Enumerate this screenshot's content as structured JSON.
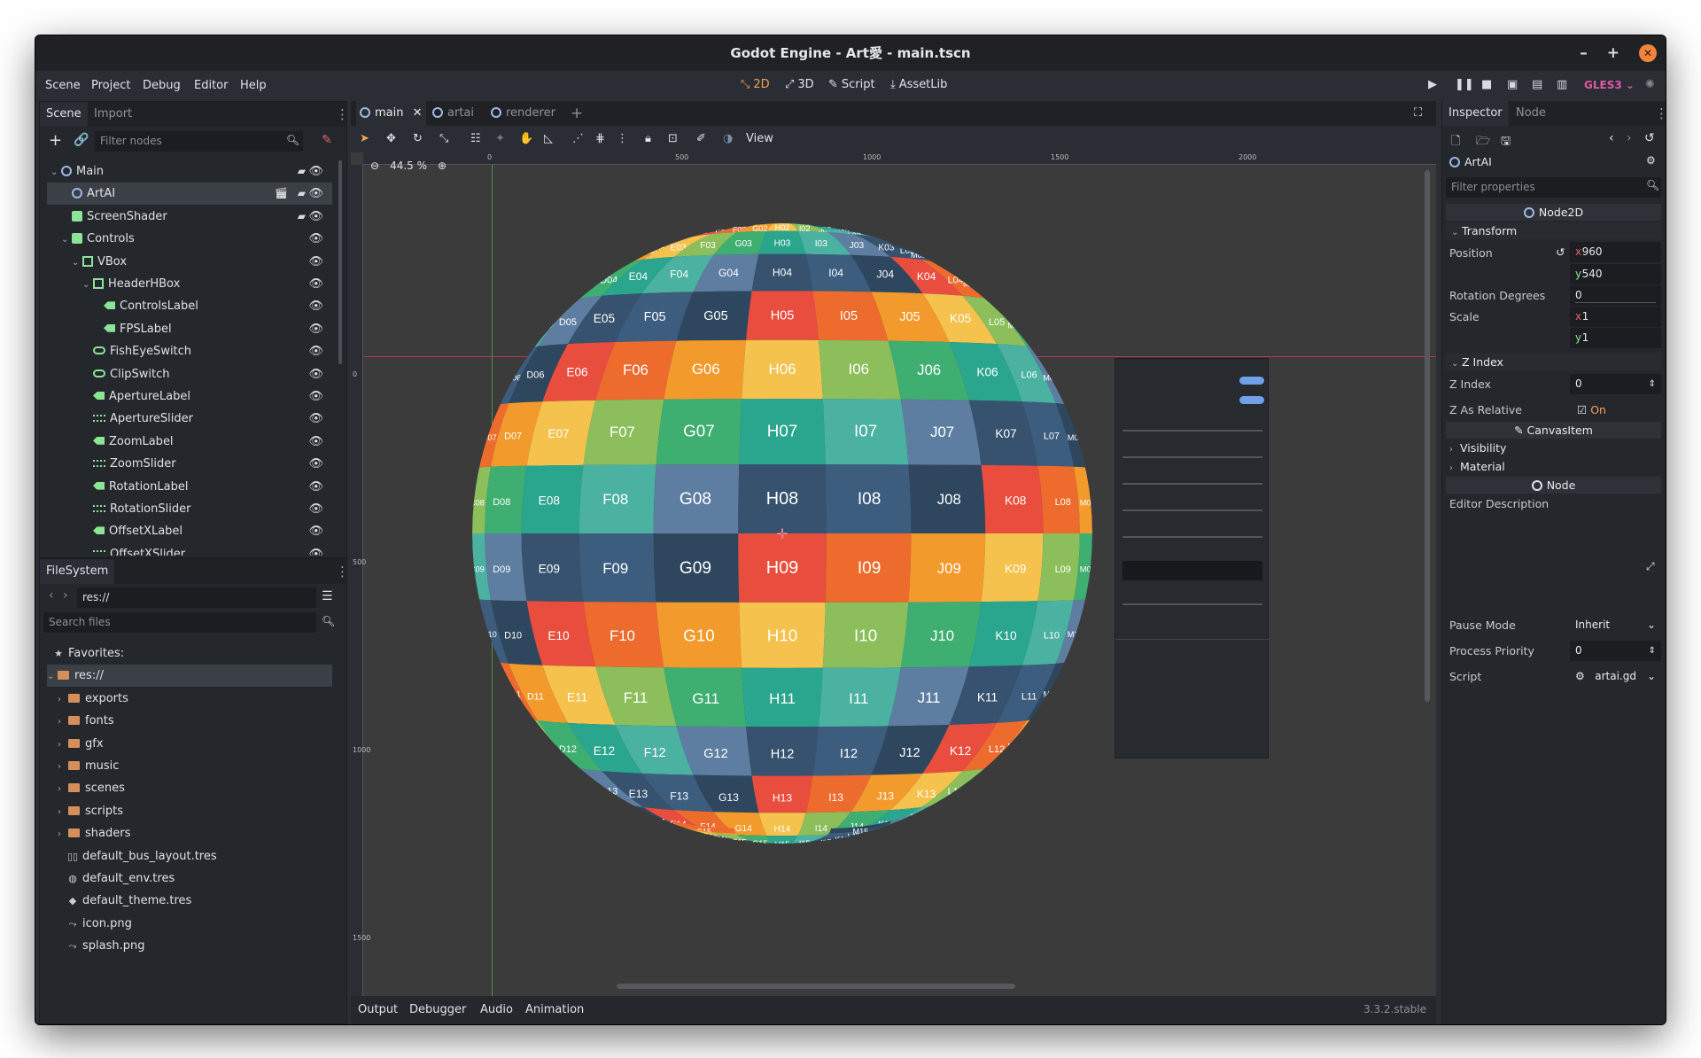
{
  "window": {
    "title": "Godot Engine - Art愛 - main.tscn"
  },
  "menus": [
    "Scene",
    "Project",
    "Debug",
    "Editor",
    "Help"
  ],
  "workspaces": [
    {
      "label": "2D",
      "icon": "2d-icon",
      "active": true
    },
    {
      "label": "3D",
      "icon": "3d-icon",
      "active": false
    },
    {
      "label": "Script",
      "icon": "script-icon",
      "active": false
    },
    {
      "label": "AssetLib",
      "icon": "assetlib-icon",
      "active": false
    }
  ],
  "renderer": "GLES3",
  "scene_panel": {
    "tabs": [
      "Scene",
      "Import"
    ],
    "filter_placeholder": "Filter nodes",
    "tree": [
      {
        "name": "Main",
        "depth": 0,
        "icon": "node2d",
        "expanded": true
      },
      {
        "name": "ArtAI",
        "depth": 1,
        "icon": "node2d",
        "selected": true
      },
      {
        "name": "ScreenShader",
        "depth": 1,
        "icon": "colorrect"
      },
      {
        "name": "Controls",
        "depth": 1,
        "icon": "control",
        "expanded": true
      },
      {
        "name": "VBox",
        "depth": 2,
        "icon": "vbox",
        "expanded": true
      },
      {
        "name": "HeaderHBox",
        "depth": 3,
        "icon": "hbox",
        "expanded": true
      },
      {
        "name": "ControlsLabel",
        "depth": 4,
        "icon": "label"
      },
      {
        "name": "FPSLabel",
        "depth": 4,
        "icon": "label"
      },
      {
        "name": "FishEyeSwitch",
        "depth": 3,
        "icon": "toggle"
      },
      {
        "name": "ClipSwitch",
        "depth": 3,
        "icon": "toggle"
      },
      {
        "name": "ApertureLabel",
        "depth": 3,
        "icon": "label"
      },
      {
        "name": "ApertureSlider",
        "depth": 3,
        "icon": "slider"
      },
      {
        "name": "ZoomLabel",
        "depth": 3,
        "icon": "label"
      },
      {
        "name": "ZoomSlider",
        "depth": 3,
        "icon": "slider"
      },
      {
        "name": "RotationLabel",
        "depth": 3,
        "icon": "label"
      },
      {
        "name": "RotationSlider",
        "depth": 3,
        "icon": "slider"
      },
      {
        "name": "OffsetXLabel",
        "depth": 3,
        "icon": "label"
      },
      {
        "name": "OffsetXSlider",
        "depth": 3,
        "icon": "slider"
      }
    ]
  },
  "filesystem": {
    "tab": "FileSystem",
    "path": "res://",
    "search_placeholder": "Search files",
    "favorites_label": "Favorites:",
    "root": "res://",
    "folders": [
      "exports",
      "fonts",
      "gfx",
      "music",
      "scenes",
      "scripts",
      "shaders"
    ],
    "files": [
      {
        "name": "default_bus_layout.tres",
        "icon": "bus-icon"
      },
      {
        "name": "default_env.tres",
        "icon": "environment-icon"
      },
      {
        "name": "default_theme.tres",
        "icon": "theme-icon"
      },
      {
        "name": "icon.png",
        "icon": "image-icon"
      },
      {
        "name": "splash.png",
        "icon": "image-icon"
      }
    ]
  },
  "editor_tabs": [
    "main",
    "artai",
    "renderer"
  ],
  "toolbar": {
    "view_label": "View"
  },
  "zoom": "44.5 %",
  "ruler": {
    "top": [
      "0",
      "500",
      "1000",
      "1500",
      "2000"
    ],
    "left": [
      "0",
      "500",
      "1000",
      "1500"
    ]
  },
  "sphere": {
    "columns": [
      "C",
      "D",
      "E",
      "F",
      "G",
      "H",
      "I",
      "J",
      "K",
      "L",
      "M"
    ],
    "rows": [
      "02",
      "03",
      "04",
      "05",
      "06",
      "07",
      "08",
      "09",
      "10",
      "11",
      "12",
      "13",
      "14",
      "15"
    ],
    "palette": [
      "#3d5d7e",
      "#2e475f",
      "#e84d3d",
      "#ec6b2d",
      "#f39a2c",
      "#f4c24d",
      "#8cbf5c",
      "#3fae71",
      "#2aa58e",
      "#4bb1a0",
      "#5e7ea1",
      "#36526e"
    ]
  },
  "bottom_panel": {
    "tabs": [
      "Output",
      "Debugger",
      "Audio",
      "Animation"
    ],
    "version": "3.3.2.stable"
  },
  "inspector": {
    "tabs": [
      "Inspector",
      "Node"
    ],
    "object": "ArtAI",
    "filter_placeholder": "Filter properties",
    "class_header": "Node2D",
    "section_transform": "Transform",
    "position_label": "Position",
    "position_x": "960",
    "position_y": "540",
    "rotation_label": "Rotation Degrees",
    "rotation_value": "0",
    "scale_label": "Scale",
    "scale_x": "1",
    "scale_y": "1",
    "section_zindex": "Z Index",
    "zindex_label": "Z Index",
    "zindex_value": "0",
    "zrel_label": "Z As Relative",
    "zrel_value": "On",
    "canvasitem_header": "CanvasItem",
    "visibility_label": "Visibility",
    "material_label": "Material",
    "node_header": "Node",
    "desc_label": "Editor Description",
    "pause_label": "Pause Mode",
    "pause_value": "Inherit",
    "priority_label": "Process Priority",
    "priority_value": "0",
    "script_label": "Script",
    "script_value": "artai.gd"
  }
}
